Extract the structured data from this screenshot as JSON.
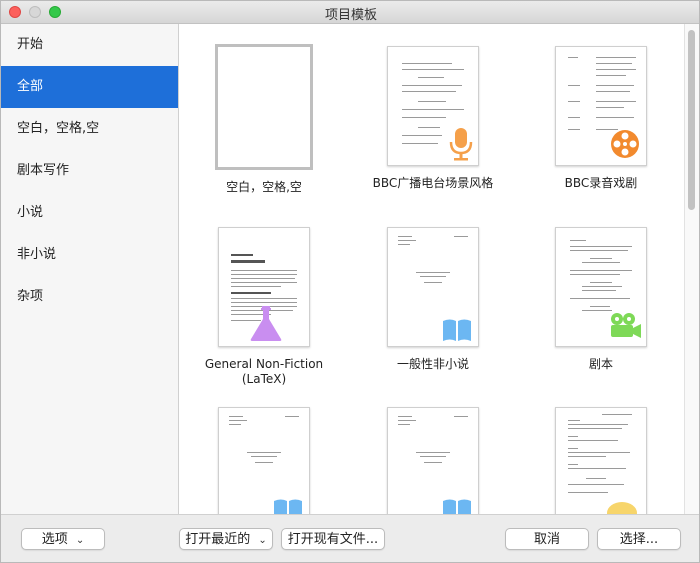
{
  "window": {
    "title": "项目模板"
  },
  "sidebar": {
    "items": [
      {
        "label": "开始"
      },
      {
        "label": "全部",
        "active": true
      },
      {
        "label": "空白，空格,空"
      },
      {
        "label": "剧本写作"
      },
      {
        "label": "小说"
      },
      {
        "label": "非小说"
      },
      {
        "label": "杂项"
      }
    ]
  },
  "templates": [
    {
      "label": "空白，空格,空",
      "icon": "blank",
      "selected": true
    },
    {
      "label": "BBC广播电台场景风格",
      "icon": "microphone-icon"
    },
    {
      "label": "BBC录音戏剧",
      "icon": "film-reel-icon"
    },
    {
      "label": "General Non-Fiction\n(LaTeX)",
      "icon": "flask-icon"
    },
    {
      "label": "一般性非小说",
      "icon": "book-icon"
    },
    {
      "label": "剧本",
      "icon": "movie-camera-icon"
    },
    {
      "label": "",
      "icon": "book-icon"
    },
    {
      "label": "",
      "icon": "book-icon"
    },
    {
      "label": "",
      "icon": "yellow-blob-icon"
    }
  ],
  "footer": {
    "options_label": "选项",
    "recent_label": "打开最近的",
    "open_existing_label": "打开现有文件...",
    "cancel_label": "取消",
    "choose_label": "选择..."
  },
  "colors": {
    "accent": "#1e6fd9",
    "microphone": "#f5a04a",
    "reel": "#f28a2e",
    "flask": "#c98ef0",
    "book": "#6cb7f2",
    "camera": "#7ed957",
    "blob": "#f7d56b"
  }
}
